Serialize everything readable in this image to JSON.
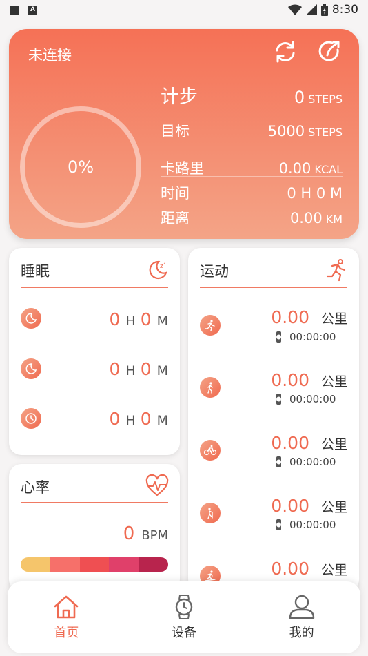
{
  "status_bar": {
    "time": "8:30"
  },
  "hero": {
    "connection_status": "未连接",
    "progress_label": "0%",
    "progress": 0,
    "steps": {
      "label": "计步",
      "value": "0",
      "unit": "STEPS"
    },
    "goal": {
      "label": "目标",
      "value": "5000",
      "unit": "STEPS"
    },
    "calories": {
      "label": "卡路里",
      "value": "0.00",
      "unit": "KCAL"
    },
    "time": {
      "label": "时间",
      "value": "0 H 0 M"
    },
    "distance": {
      "label": "距离",
      "value": "0.00",
      "unit": "KM"
    }
  },
  "sleep": {
    "title": "睡眠",
    "rows": [
      {
        "icon": "moon-icon",
        "hours": "0",
        "hours_unit": "H",
        "minutes": "0",
        "minutes_unit": "M"
      },
      {
        "icon": "moon-icon",
        "hours": "0",
        "hours_unit": "H",
        "minutes": "0",
        "minutes_unit": "M"
      },
      {
        "icon": "clock-icon",
        "hours": "0",
        "hours_unit": "H",
        "minutes": "0",
        "minutes_unit": "M"
      }
    ]
  },
  "heart": {
    "title": "心率",
    "value": "0",
    "unit": "BPM"
  },
  "sport": {
    "title": "运动",
    "rows": [
      {
        "icon": "run-icon",
        "value": "0.00",
        "unit": "公里",
        "time": "00:00:00"
      },
      {
        "icon": "walk-icon",
        "value": "0.00",
        "unit": "公里",
        "time": "00:00:00"
      },
      {
        "icon": "bike-icon",
        "value": "0.00",
        "unit": "公里",
        "time": "00:00:00"
      },
      {
        "icon": "climb-icon",
        "value": "0.00",
        "unit": "公里",
        "time": "00:00:00"
      },
      {
        "icon": "treadmill-icon",
        "value": "0.00",
        "unit": "公里"
      }
    ]
  },
  "nav": {
    "home": "首页",
    "device": "设备",
    "me": "我的"
  },
  "colors": {
    "accent": "#ef6a51",
    "hero_top": "#f57156",
    "hero_bottom": "#f4a487"
  }
}
